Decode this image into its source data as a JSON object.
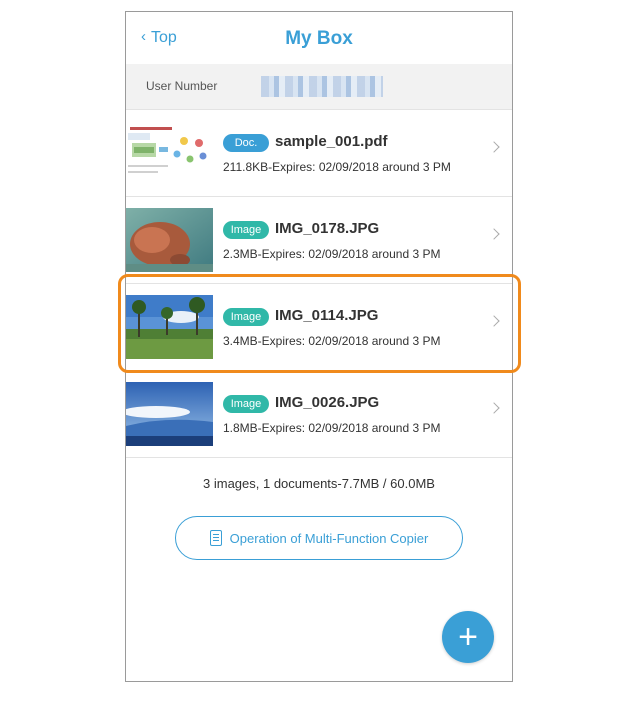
{
  "header": {
    "back_label": "Top",
    "title": "My Box"
  },
  "user": {
    "label": "User Number"
  },
  "files": [
    {
      "type_label": "Doc.",
      "name": "sample_001.pdf",
      "meta": "211.8KB-Expires: 02/09/2018 around 3 PM"
    },
    {
      "type_label": "Image",
      "name": "IMG_0178.JPG",
      "meta": "2.3MB-Expires: 02/09/2018 around 3 PM"
    },
    {
      "type_label": "Image",
      "name": "IMG_0114.JPG",
      "meta": "3.4MB-Expires: 02/09/2018 around 3 PM"
    },
    {
      "type_label": "Image",
      "name": "IMG_0026.JPG",
      "meta": "1.8MB-Expires: 02/09/2018 around 3 PM"
    }
  ],
  "summary": "3 images, 1 documents-7.7MB / 60.0MB",
  "operation_button_label": "Operation of Multi-Function Copier",
  "fab_label": "+",
  "colors": {
    "accent": "#3a9fd6",
    "image_badge": "#30b8a8",
    "highlight": "#f08a1c"
  }
}
